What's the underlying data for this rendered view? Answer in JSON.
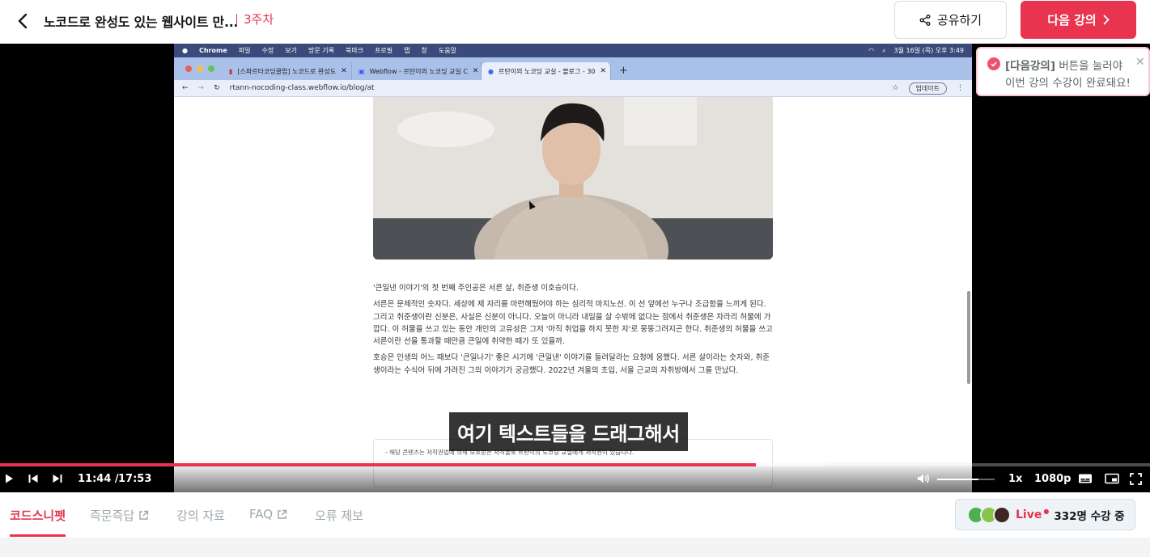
{
  "header": {
    "course_title": "노코드로 완성도 있는 웹사이트 만...",
    "week": "3주차",
    "share_label": "공유하기",
    "next_label": "다음 강의"
  },
  "toast": {
    "highlight": "[다음강의]",
    "line1_rest": " 버튼을 눌러야",
    "line2": "이번 강의 수강이 완료돼요!"
  },
  "video": {
    "mac_menubar": {
      "app": "Chrome",
      "items": [
        "파일",
        "수정",
        "보기",
        "방문 기록",
        "북마크",
        "프로필",
        "탭",
        "창",
        "도움말"
      ],
      "clock": "3월 16일 (목) 오후 3:49"
    },
    "browser_tabs": [
      {
        "title": "[스파르타코딩클럽] 노코드로 완성도"
      },
      {
        "title": "Webflow - 르탄이의 노코딩 교실 C"
      },
      {
        "title": "르탄이의 노코딩 교실 - 블로그 - 30"
      }
    ],
    "url": "rtann-nocoding-class.webflow.io/blog/at",
    "update_label": "업데이트",
    "paragraphs": [
      "'큰일낸 이야기'의 첫 번째 주인공은 서른 살, 취준생 이호승이다.",
      "서른은 문제적인 숫자다. 세상에 제 자리를 마련해뒀어야 하는 심리적 마지노선. 이 선 앞에선 누구나 조급함을 느끼게 된다. 그리고 취준생이란 신분은, 사실은 신분이 아니다. 오늘이 아니라 내일을 살 수밖에 없다는 점에서 취준생은 차라리 허물에 가깝다. 이 허물을 쓰고 있는 동안 개인의 고유성은 그저 '아직 취업을 하지 못한 자'로 뭉뚱그려지곤 한다. 취준생의 허물을 쓰고 서른이란 선을 통과할 때만큼 큰일에 취약한 때가 또 있을까.",
      "호승은 인생의 어느 때보다 '큰일나기' 좋은 시기에 '큰일낸' 이야기를 들려달라는 요청에 응했다. 서른 살이라는 숫자와, 취준생이라는 수식어 뒤에 가려진 그의 이야기가 궁금했다. 2022년 겨울의 초입, 서울 근교의 자취방에서 그를 만났다."
    ],
    "notice": "- 해당 콘텐츠는 저작권법에 의해 보호받는 저작물로 르탄이의 노코딩 교실에게 저작권이 있습니다.",
    "subtitle": "여기 텍스트들을 드래그해서",
    "current_time": "11:44 /",
    "total_time": "17:53",
    "progress": 0.657,
    "buffered": 0.717,
    "volume": 0.72,
    "speed": "1x",
    "quality": "1080p"
  },
  "bottom_tabs": [
    {
      "label": "코드스니펫"
    },
    {
      "label": "즉문즉답"
    },
    {
      "label": "강의 자료"
    },
    {
      "label": "FAQ"
    },
    {
      "label": "오류 제보"
    }
  ],
  "live": {
    "label": "Live",
    "count": "332명 수강 중"
  },
  "colors": {
    "accent": "#e8344e",
    "muted": "#9da7ae"
  }
}
